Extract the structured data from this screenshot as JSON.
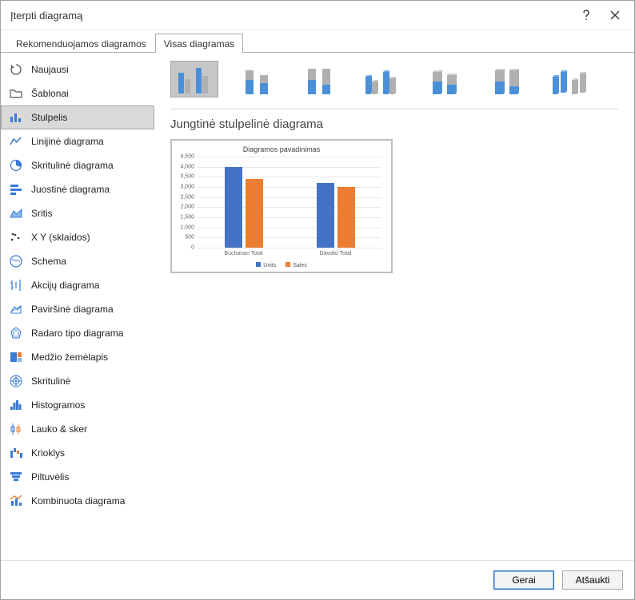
{
  "titlebar": {
    "title": "Įterpti diagramą"
  },
  "tabs": {
    "recommended": "Rekomenduojamos diagramos",
    "all": "Visas diagramas"
  },
  "sidebar": {
    "items": [
      {
        "id": "recent",
        "label": "Naujausi"
      },
      {
        "id": "templates",
        "label": "Šablonai"
      },
      {
        "id": "column",
        "label": "Stulpelis"
      },
      {
        "id": "line",
        "label": "Linijinė diagrama"
      },
      {
        "id": "pie",
        "label": "Skritulinė diagrama"
      },
      {
        "id": "bar",
        "label": "Juostinė diagrama"
      },
      {
        "id": "area",
        "label": "Sritis"
      },
      {
        "id": "xy",
        "label": "X Y (sklaidos)"
      },
      {
        "id": "map",
        "label": "Schema"
      },
      {
        "id": "stock",
        "label": "Akcijų diagrama"
      },
      {
        "id": "surface",
        "label": "Paviršinė diagrama"
      },
      {
        "id": "radar",
        "label": "Radaro tipo diagrama"
      },
      {
        "id": "treemap",
        "label": "Medžio žemėlapis"
      },
      {
        "id": "sunburst",
        "label": "Skritulinė"
      },
      {
        "id": "histogram",
        "label": "Histogramos"
      },
      {
        "id": "boxwhisker",
        "label": "Lauko & sker"
      },
      {
        "id": "waterfall",
        "label": "Krioklys"
      },
      {
        "id": "funnel",
        "label": "Piltuvėlis"
      },
      {
        "id": "combo",
        "label": "Kombinuota diagrama"
      }
    ]
  },
  "content": {
    "subtype_title": "Jungtinė stulpelinė diagrama"
  },
  "buttons": {
    "ok": "Gerai",
    "cancel": "Atšaukti"
  },
  "chart_data": {
    "type": "bar",
    "title": "Diagramos pavadinimas",
    "categories": [
      "Buchanan Total",
      "Davolio Total"
    ],
    "series": [
      {
        "name": "Units",
        "values": [
          4000,
          3200
        ],
        "color": "#4472C4"
      },
      {
        "name": "Sales",
        "values": [
          3400,
          3000
        ],
        "color": "#ED7D31"
      }
    ],
    "ylim": [
      0,
      4500
    ],
    "y_ticks": [
      0,
      500,
      1000,
      1500,
      2000,
      2500,
      3000,
      3500,
      4000,
      4500
    ],
    "legend_position": "bottom"
  }
}
